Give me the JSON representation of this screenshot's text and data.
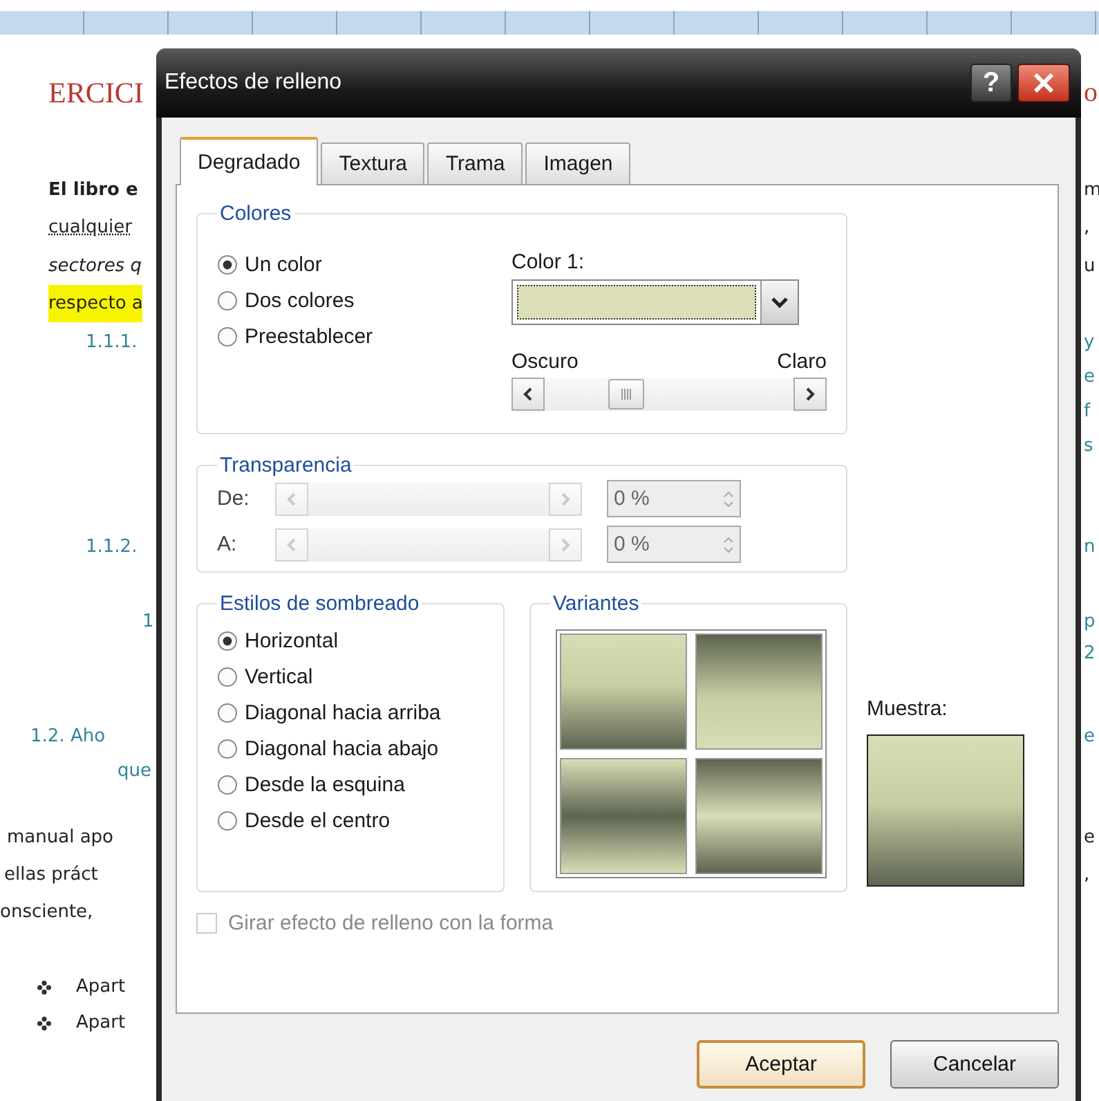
{
  "document": {
    "left_lines": [
      {
        "kind": "heading",
        "text": "ERCICI"
      },
      {
        "kind": "bold",
        "text": "El libro e"
      },
      {
        "kind": "dotted",
        "text": "cualquier"
      },
      {
        "kind": "italic",
        "text": "sectores q"
      },
      {
        "kind": "highlight",
        "text": "respecto a"
      },
      {
        "kind": "number",
        "text": "1.1.1."
      },
      {
        "kind": "number",
        "text": "1.1.2."
      },
      {
        "kind": "number",
        "text": "1"
      },
      {
        "kind": "number",
        "text": "1.2. Aho"
      },
      {
        "kind": "number",
        "text": "que"
      },
      {
        "kind": "body",
        "text": "manual apo"
      },
      {
        "kind": "body",
        "text": "ellas práct"
      },
      {
        "kind": "body",
        "text": "onsciente,"
      },
      {
        "kind": "bullet",
        "text": "Apart"
      },
      {
        "kind": "bullet",
        "text": "Apart"
      }
    ],
    "right_lines": [
      {
        "kind": "heading",
        "text": "o"
      },
      {
        "kind": "body",
        "text": "m"
      },
      {
        "kind": "body",
        "text": ","
      },
      {
        "kind": "body",
        "text": "u"
      },
      {
        "kind": "number",
        "text": "y"
      },
      {
        "kind": "number",
        "text": "e"
      },
      {
        "kind": "number",
        "text": "f"
      },
      {
        "kind": "number",
        "text": "s"
      },
      {
        "kind": "number",
        "text": "n"
      },
      {
        "kind": "number",
        "text": "p"
      },
      {
        "kind": "number",
        "text": "2"
      },
      {
        "kind": "number",
        "text": "e"
      },
      {
        "kind": "body",
        "text": "e"
      },
      {
        "kind": "body",
        "text": ","
      }
    ]
  },
  "dialog": {
    "title": "Efectos de relleno",
    "help_label": "?",
    "tabs": [
      {
        "label": "Degradado",
        "selected": true
      },
      {
        "label": "Textura",
        "selected": false
      },
      {
        "label": "Trama",
        "selected": false
      },
      {
        "label": "Imagen",
        "selected": false
      }
    ],
    "colors": {
      "legend": "Colores",
      "options": [
        {
          "label": "Un color",
          "selected": true
        },
        {
          "label": "Dos colores",
          "selected": false
        },
        {
          "label": "Preestablecer",
          "selected": false
        }
      ],
      "color_1_label": "Color 1:",
      "dark_label": "Oscuro",
      "light_label": "Claro",
      "brightness": {
        "level": 0.3
      }
    },
    "transparency": {
      "legend": "Transparencia",
      "disabled": true,
      "rows": [
        {
          "label": "De:",
          "value": "0 %"
        },
        {
          "label": "A:",
          "value": "0 %"
        }
      ]
    },
    "shading": {
      "legend": "Estilos de sombreado",
      "options": [
        {
          "label": "Horizontal",
          "selected": true
        },
        {
          "label": "Vertical",
          "selected": false
        },
        {
          "label": "Diagonal hacia arriba",
          "selected": false
        },
        {
          "label": "Diagonal hacia abajo",
          "selected": false
        },
        {
          "label": "Desde la esquina",
          "selected": false
        },
        {
          "label": "Desde el centro",
          "selected": false
        }
      ]
    },
    "variants": {
      "legend": "Variantes",
      "items": [
        {
          "kind": "fade-down"
        },
        {
          "kind": "fade-up"
        },
        {
          "kind": "dark-band"
        },
        {
          "kind": "light-band"
        }
      ]
    },
    "sample_label": "Muestra:",
    "rotate_checkbox": {
      "label": "Girar efecto de relleno con la forma",
      "checked": false,
      "disabled": true
    },
    "buttons": [
      {
        "label": "Aceptar",
        "default": true
      },
      {
        "label": "Cancelar",
        "default": false
      }
    ]
  }
}
